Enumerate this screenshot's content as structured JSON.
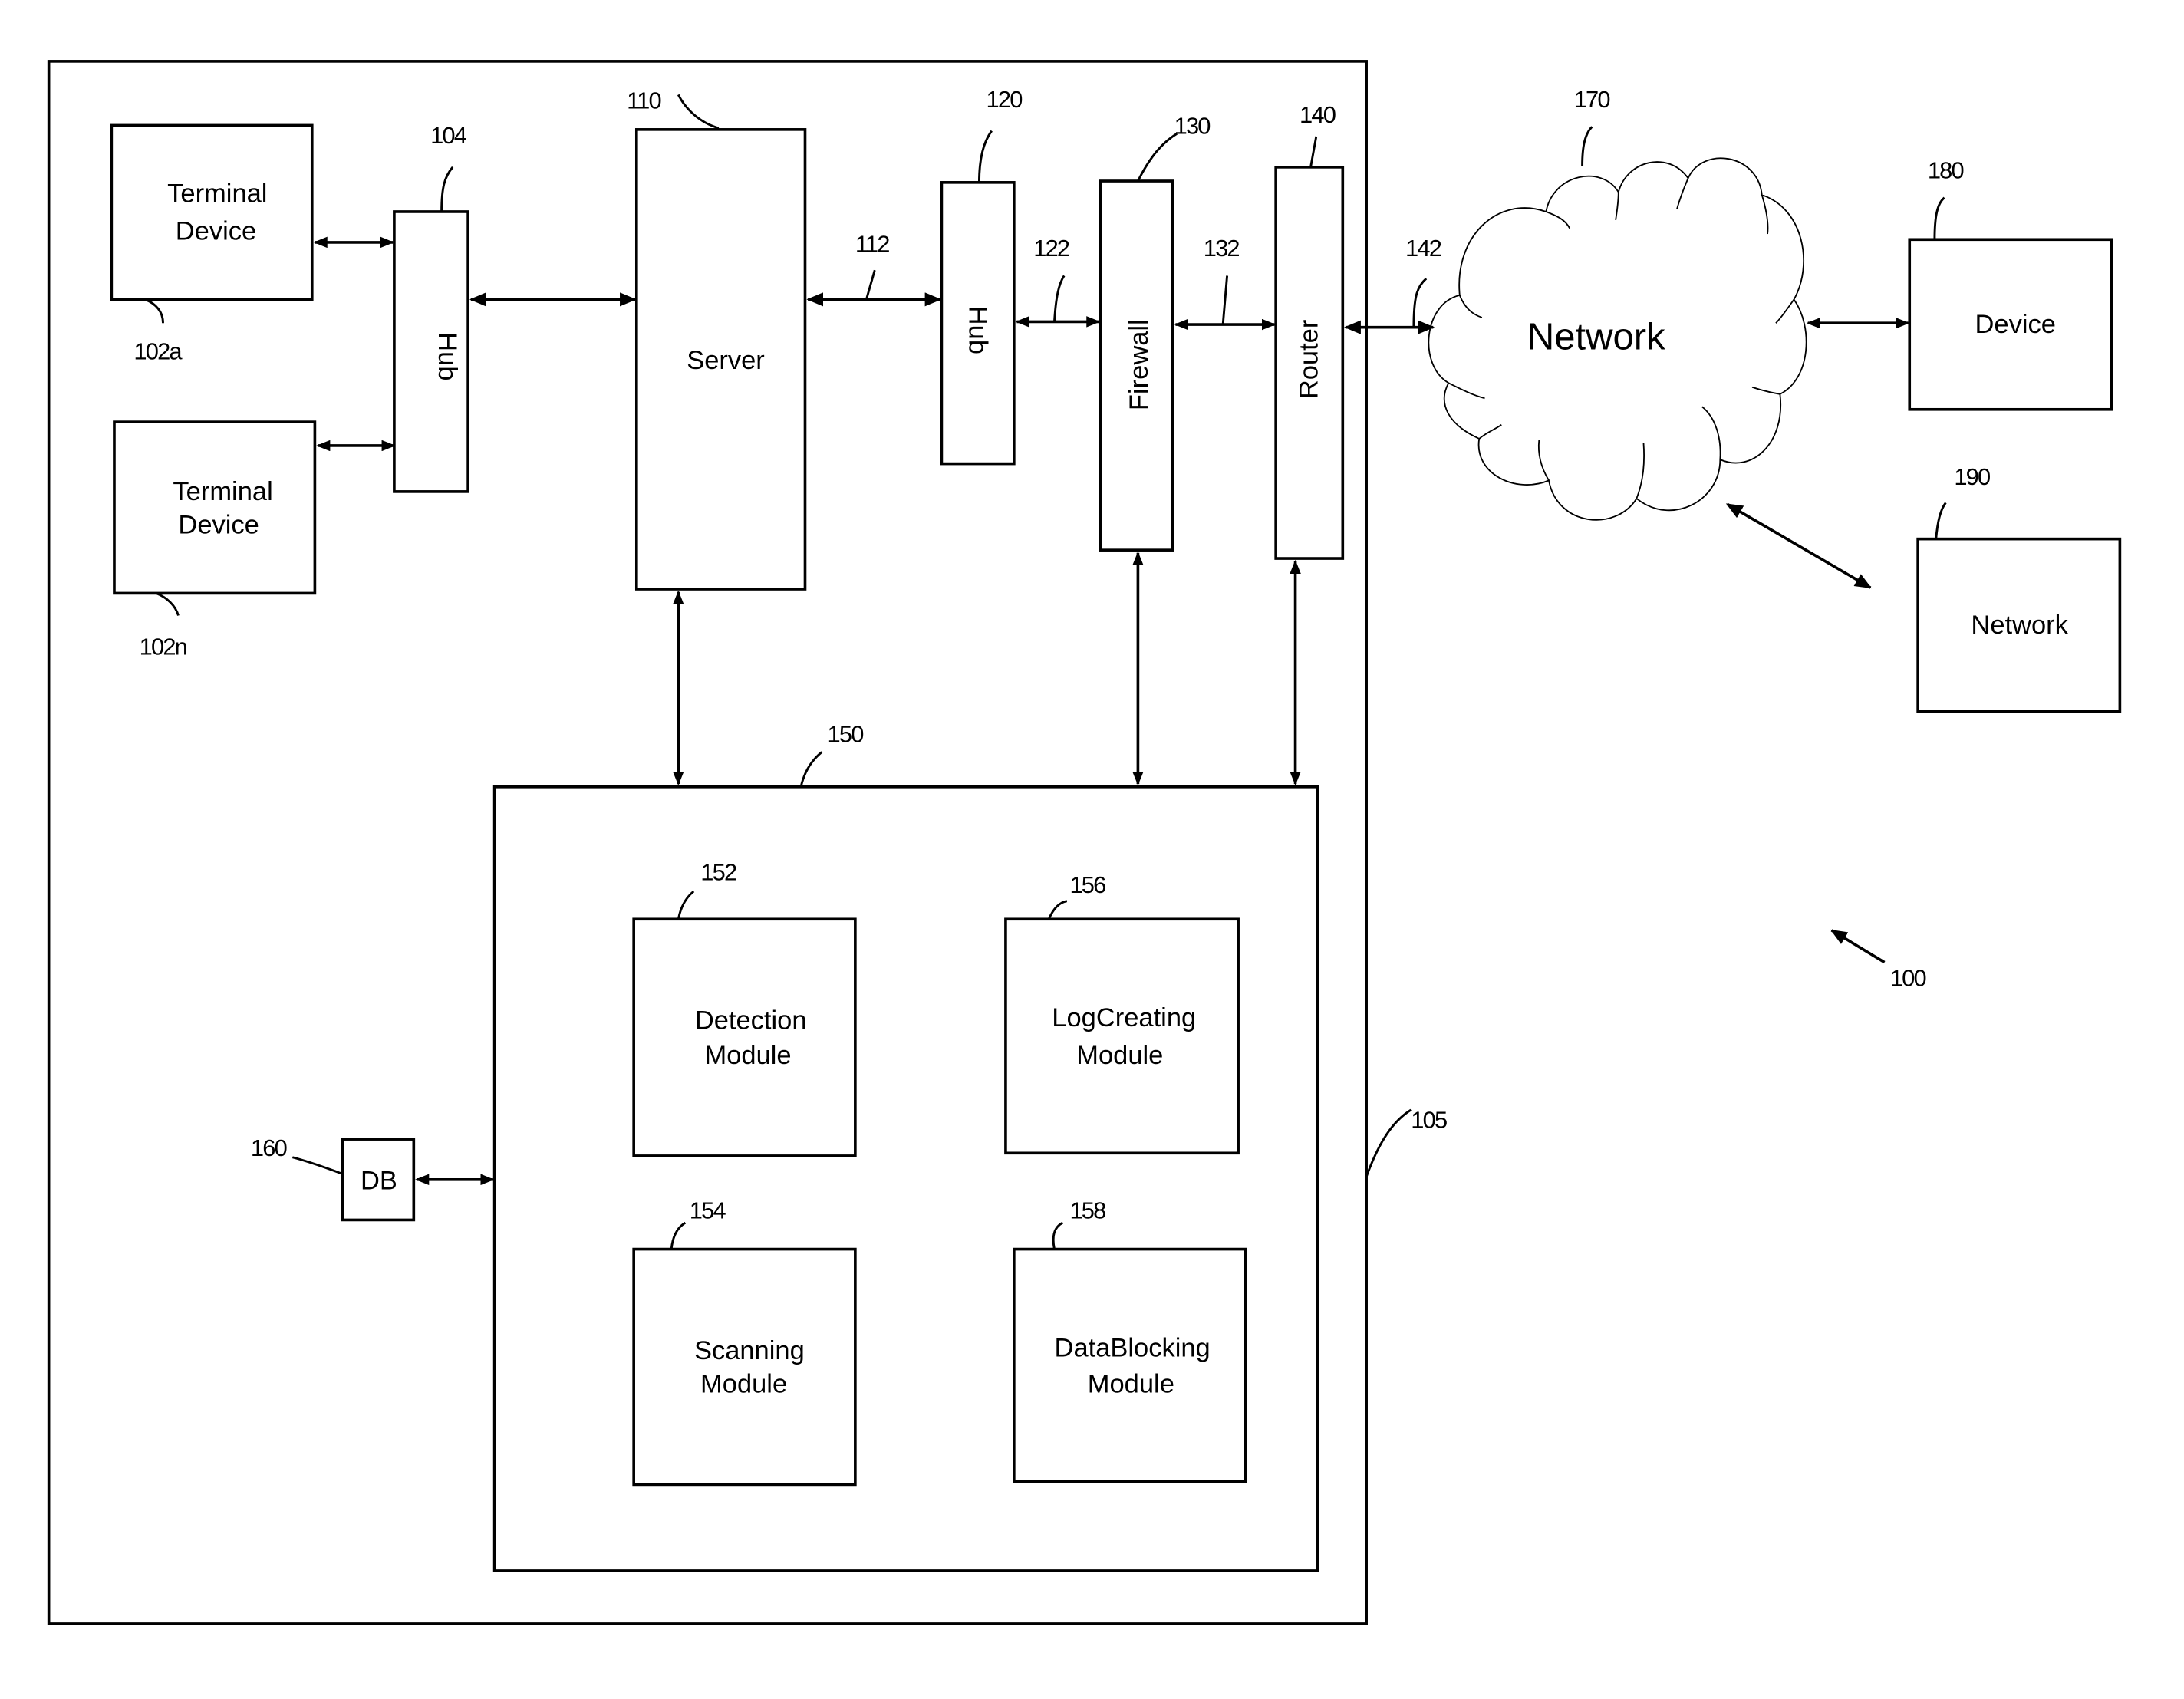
{
  "figure": {
    "reference": "100",
    "enclosure_ref": "105"
  },
  "nodes": {
    "terminal_a": {
      "label_line1": "Terminal",
      "label_line2": "Device",
      "ref": "102a"
    },
    "terminal_n": {
      "label_line1": "Terminal",
      "label_line2": "Device",
      "ref": "102n"
    },
    "hub_104": {
      "label": "Hub",
      "ref": "104"
    },
    "server": {
      "label": "Server",
      "ref": "110"
    },
    "hub_120": {
      "label": "Hub",
      "ref": "120"
    },
    "firewall": {
      "label": "Firewall",
      "ref": "130"
    },
    "router": {
      "label": "Router",
      "ref": "140"
    },
    "network_cloud": {
      "label": "Network",
      "ref": "170"
    },
    "device": {
      "label": "Device",
      "ref": "180"
    },
    "network_box": {
      "label": "Network",
      "ref": "190"
    },
    "security_system": {
      "ref": "150"
    },
    "detection": {
      "label_line1": "Detection",
      "label_line2": "Module",
      "ref": "152"
    },
    "scanning": {
      "label_line1": "Scanning",
      "label_line2": "Module",
      "ref": "154"
    },
    "log_creating": {
      "label_line1": "LogCreating",
      "label_line2": "Module",
      "ref": "156"
    },
    "data_blocking": {
      "label_line1": "DataBlocking",
      "label_line2": "Module",
      "ref": "158"
    },
    "db": {
      "label": "DB",
      "ref": "160"
    }
  },
  "links": {
    "server_hub120": "112",
    "hub120_firewall": "122",
    "firewall_router": "132",
    "router_network": "142"
  },
  "colors": {
    "stroke": "#000000",
    "background": "#ffffff"
  }
}
